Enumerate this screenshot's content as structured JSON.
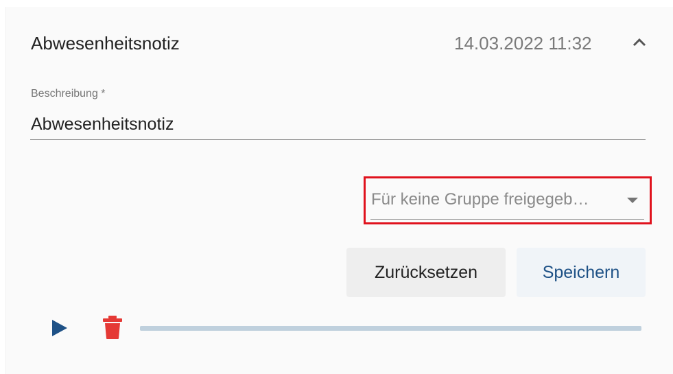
{
  "header": {
    "title": "Abwesenheitsnotiz",
    "timestamp": "14.03.2022 11:32",
    "collapse_icon": "chevron-up-icon"
  },
  "description_field": {
    "label": "Beschreibung *",
    "value": "Abwesenheitsnotiz"
  },
  "group_select": {
    "selected_text": "Für keine Gruppe freigegeb…",
    "arrow_icon": "dropdown-arrow-icon"
  },
  "buttons": {
    "reset_label": "Zurücksetzen",
    "save_label": "Speichern"
  },
  "audio_player": {
    "play_icon": "play-icon",
    "delete_icon": "trash-icon",
    "progress": 0
  },
  "colors": {
    "accent": "#1e5186",
    "delete": "#e53935",
    "highlight": "#e0121d",
    "progress_track": "#bfd0dd"
  }
}
